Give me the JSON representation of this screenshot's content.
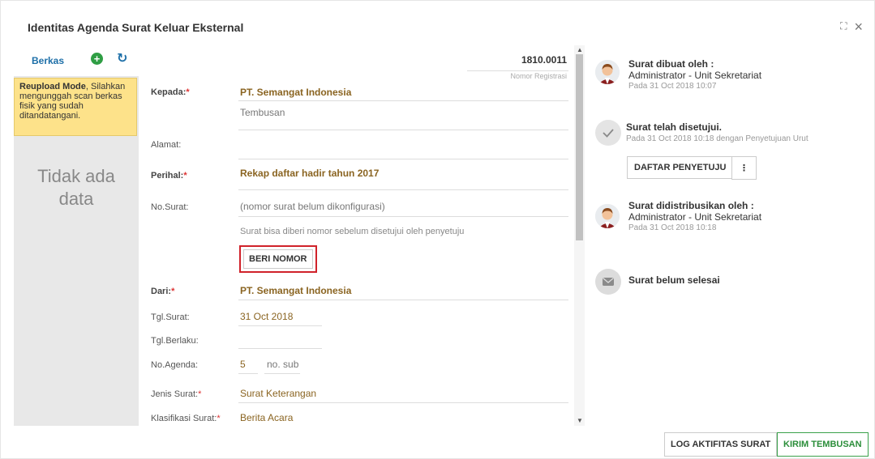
{
  "modal": {
    "title": "Identitas Agenda Surat Keluar Eksternal"
  },
  "left": {
    "berkas_label": "Berkas",
    "notice_bold": "Reupload Mode",
    "notice_text": ", Silahkan mengunggah scan berkas fisik yang sudah ditandatangani.",
    "empty_line1": "Tidak ada",
    "empty_line2": "data"
  },
  "form": {
    "reg_no": "1810.0011",
    "reg_label": "Nomor Registrasi",
    "kepada_label": "Kepada:",
    "kepada_value": "PT. Semangat Indonesia",
    "tembusan_placeholder": "Tembusan",
    "alamat_label": "Alamat:",
    "perihal_label": "Perihal:",
    "perihal_value": "Rekap daftar hadir tahun 2017",
    "nosurat_label": "No.Surat:",
    "nosurat_value": "(nomor surat belum dikonfigurasi)",
    "nosurat_hint": "Surat bisa diberi nomor sebelum disetujui oleh penyetuju",
    "beri_nomor": "BERI NOMOR",
    "dari_label": "Dari:",
    "dari_value": "PT. Semangat Indonesia",
    "tgl_surat_label": "Tgl.Surat:",
    "tgl_surat_value": "31 Oct 2018",
    "tgl_berlaku_label": "Tgl.Berlaku:",
    "no_agenda_label": "No.Agenda:",
    "no_agenda_value": "5",
    "no_sub_placeholder": "no. sub",
    "jenis_label": "Jenis Surat:",
    "jenis_value": "Surat Keterangan",
    "klasifikasi_label": "Klasifikasi Surat:",
    "klasifikasi_value": "Berita Acara",
    "required_mark": "*"
  },
  "timeline": {
    "created_title": "Surat dibuat oleh :",
    "created_by": "Administrator - Unit Sekretariat",
    "created_time": "Pada 31 Oct 2018 10:07",
    "approved_title": "Surat telah disetujui.",
    "approved_time": "Pada 31 Oct 2018 10:18 dengan Penyetujuan Urut",
    "daftar_btn": "DAFTAR PENYETUJU",
    "more_btn": "⋮",
    "dist_title": "Surat didistribusikan oleh :",
    "dist_by": "Administrator - Unit Sekretariat",
    "dist_time": "Pada 31 Oct 2018 10:18",
    "unfinished_title": "Surat belum selesai"
  },
  "footer": {
    "log_btn": "LOG AKTIFITAS SURAT",
    "kirim_btn": "KIRIM TEMBUSAN"
  },
  "colors": {
    "accent_blue": "#1d6fa8",
    "gold": "#8a6421",
    "highlight_red": "#d0222a",
    "green": "#3aa14a"
  }
}
